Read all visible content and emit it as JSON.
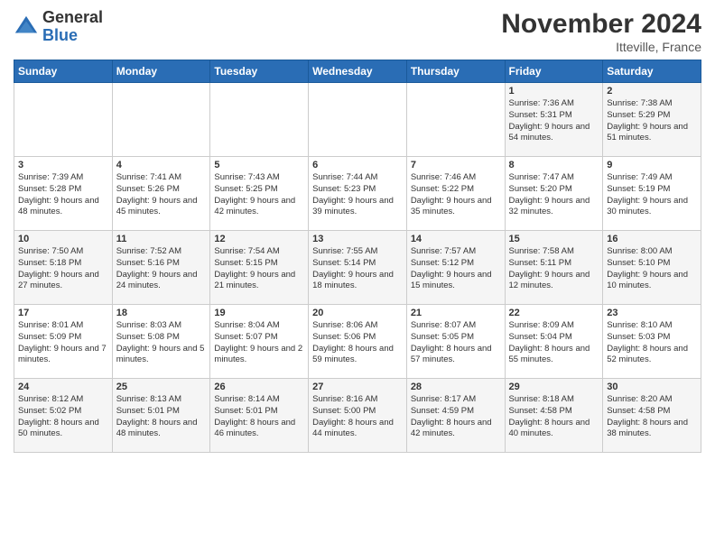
{
  "header": {
    "logo_general": "General",
    "logo_blue": "Blue",
    "month_title": "November 2024",
    "location": "Itteville, France"
  },
  "weekdays": [
    "Sunday",
    "Monday",
    "Tuesday",
    "Wednesday",
    "Thursday",
    "Friday",
    "Saturday"
  ],
  "weeks": [
    [
      {
        "day": "",
        "info": ""
      },
      {
        "day": "",
        "info": ""
      },
      {
        "day": "",
        "info": ""
      },
      {
        "day": "",
        "info": ""
      },
      {
        "day": "",
        "info": ""
      },
      {
        "day": "1",
        "info": "Sunrise: 7:36 AM\nSunset: 5:31 PM\nDaylight: 9 hours\nand 54 minutes."
      },
      {
        "day": "2",
        "info": "Sunrise: 7:38 AM\nSunset: 5:29 PM\nDaylight: 9 hours\nand 51 minutes."
      }
    ],
    [
      {
        "day": "3",
        "info": "Sunrise: 7:39 AM\nSunset: 5:28 PM\nDaylight: 9 hours\nand 48 minutes."
      },
      {
        "day": "4",
        "info": "Sunrise: 7:41 AM\nSunset: 5:26 PM\nDaylight: 9 hours\nand 45 minutes."
      },
      {
        "day": "5",
        "info": "Sunrise: 7:43 AM\nSunset: 5:25 PM\nDaylight: 9 hours\nand 42 minutes."
      },
      {
        "day": "6",
        "info": "Sunrise: 7:44 AM\nSunset: 5:23 PM\nDaylight: 9 hours\nand 39 minutes."
      },
      {
        "day": "7",
        "info": "Sunrise: 7:46 AM\nSunset: 5:22 PM\nDaylight: 9 hours\nand 35 minutes."
      },
      {
        "day": "8",
        "info": "Sunrise: 7:47 AM\nSunset: 5:20 PM\nDaylight: 9 hours\nand 32 minutes."
      },
      {
        "day": "9",
        "info": "Sunrise: 7:49 AM\nSunset: 5:19 PM\nDaylight: 9 hours\nand 30 minutes."
      }
    ],
    [
      {
        "day": "10",
        "info": "Sunrise: 7:50 AM\nSunset: 5:18 PM\nDaylight: 9 hours\nand 27 minutes."
      },
      {
        "day": "11",
        "info": "Sunrise: 7:52 AM\nSunset: 5:16 PM\nDaylight: 9 hours\nand 24 minutes."
      },
      {
        "day": "12",
        "info": "Sunrise: 7:54 AM\nSunset: 5:15 PM\nDaylight: 9 hours\nand 21 minutes."
      },
      {
        "day": "13",
        "info": "Sunrise: 7:55 AM\nSunset: 5:14 PM\nDaylight: 9 hours\nand 18 minutes."
      },
      {
        "day": "14",
        "info": "Sunrise: 7:57 AM\nSunset: 5:12 PM\nDaylight: 9 hours\nand 15 minutes."
      },
      {
        "day": "15",
        "info": "Sunrise: 7:58 AM\nSunset: 5:11 PM\nDaylight: 9 hours\nand 12 minutes."
      },
      {
        "day": "16",
        "info": "Sunrise: 8:00 AM\nSunset: 5:10 PM\nDaylight: 9 hours\nand 10 minutes."
      }
    ],
    [
      {
        "day": "17",
        "info": "Sunrise: 8:01 AM\nSunset: 5:09 PM\nDaylight: 9 hours\nand 7 minutes."
      },
      {
        "day": "18",
        "info": "Sunrise: 8:03 AM\nSunset: 5:08 PM\nDaylight: 9 hours\nand 5 minutes."
      },
      {
        "day": "19",
        "info": "Sunrise: 8:04 AM\nSunset: 5:07 PM\nDaylight: 9 hours\nand 2 minutes."
      },
      {
        "day": "20",
        "info": "Sunrise: 8:06 AM\nSunset: 5:06 PM\nDaylight: 8 hours\nand 59 minutes."
      },
      {
        "day": "21",
        "info": "Sunrise: 8:07 AM\nSunset: 5:05 PM\nDaylight: 8 hours\nand 57 minutes."
      },
      {
        "day": "22",
        "info": "Sunrise: 8:09 AM\nSunset: 5:04 PM\nDaylight: 8 hours\nand 55 minutes."
      },
      {
        "day": "23",
        "info": "Sunrise: 8:10 AM\nSunset: 5:03 PM\nDaylight: 8 hours\nand 52 minutes."
      }
    ],
    [
      {
        "day": "24",
        "info": "Sunrise: 8:12 AM\nSunset: 5:02 PM\nDaylight: 8 hours\nand 50 minutes."
      },
      {
        "day": "25",
        "info": "Sunrise: 8:13 AM\nSunset: 5:01 PM\nDaylight: 8 hours\nand 48 minutes."
      },
      {
        "day": "26",
        "info": "Sunrise: 8:14 AM\nSunset: 5:01 PM\nDaylight: 8 hours\nand 46 minutes."
      },
      {
        "day": "27",
        "info": "Sunrise: 8:16 AM\nSunset: 5:00 PM\nDaylight: 8 hours\nand 44 minutes."
      },
      {
        "day": "28",
        "info": "Sunrise: 8:17 AM\nSunset: 4:59 PM\nDaylight: 8 hours\nand 42 minutes."
      },
      {
        "day": "29",
        "info": "Sunrise: 8:18 AM\nSunset: 4:58 PM\nDaylight: 8 hours\nand 40 minutes."
      },
      {
        "day": "30",
        "info": "Sunrise: 8:20 AM\nSunset: 4:58 PM\nDaylight: 8 hours\nand 38 minutes."
      }
    ]
  ]
}
